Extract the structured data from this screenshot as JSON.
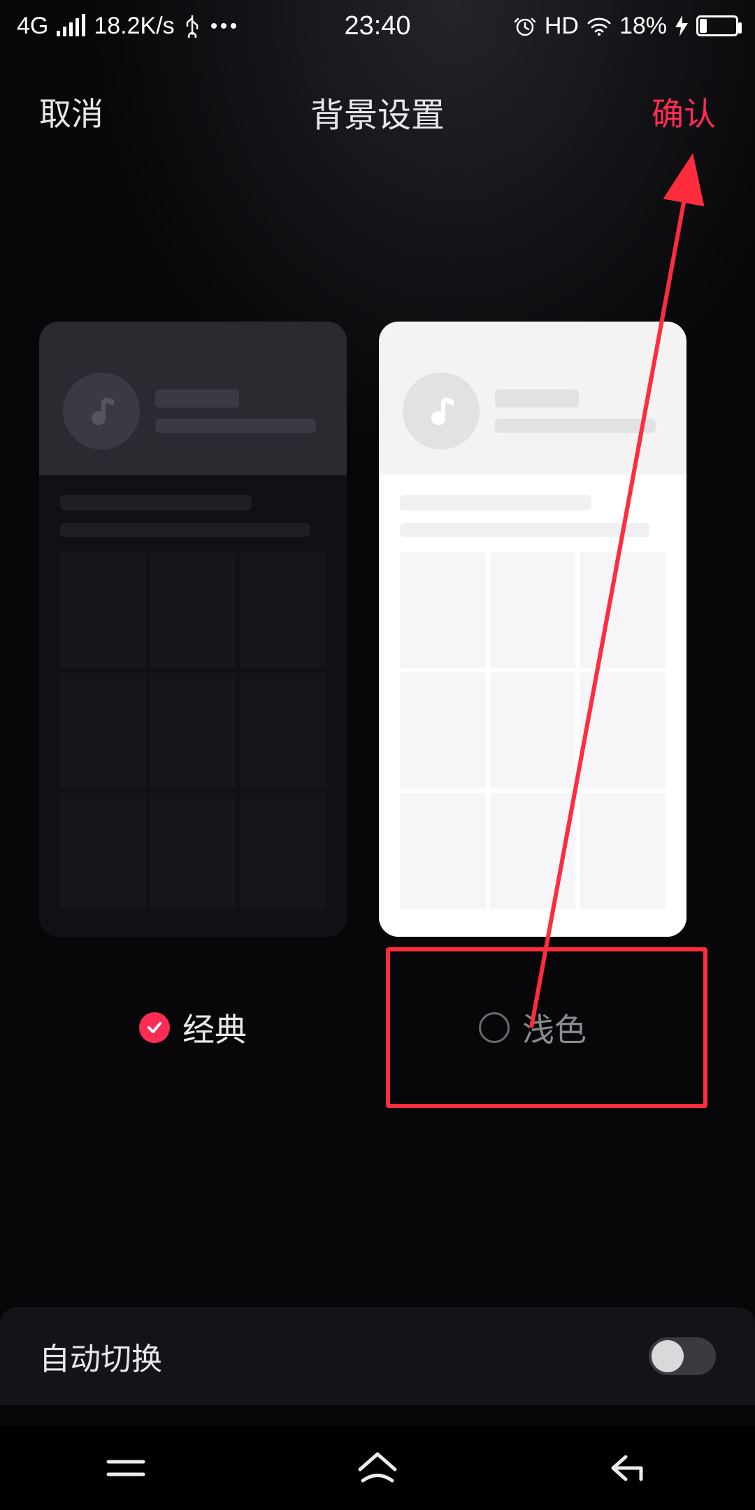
{
  "status": {
    "network": "4G",
    "speed": "18.2K/s",
    "time": "23:40",
    "hd": "HD",
    "battery_pct": "18%"
  },
  "header": {
    "cancel": "取消",
    "title": "背景设置",
    "confirm": "确认"
  },
  "options": {
    "classic": "经典",
    "light": "浅色"
  },
  "auto_switch": {
    "label": "自动切换"
  },
  "colors": {
    "accent": "#fe2c55",
    "annotation": "#fe2c3d"
  }
}
